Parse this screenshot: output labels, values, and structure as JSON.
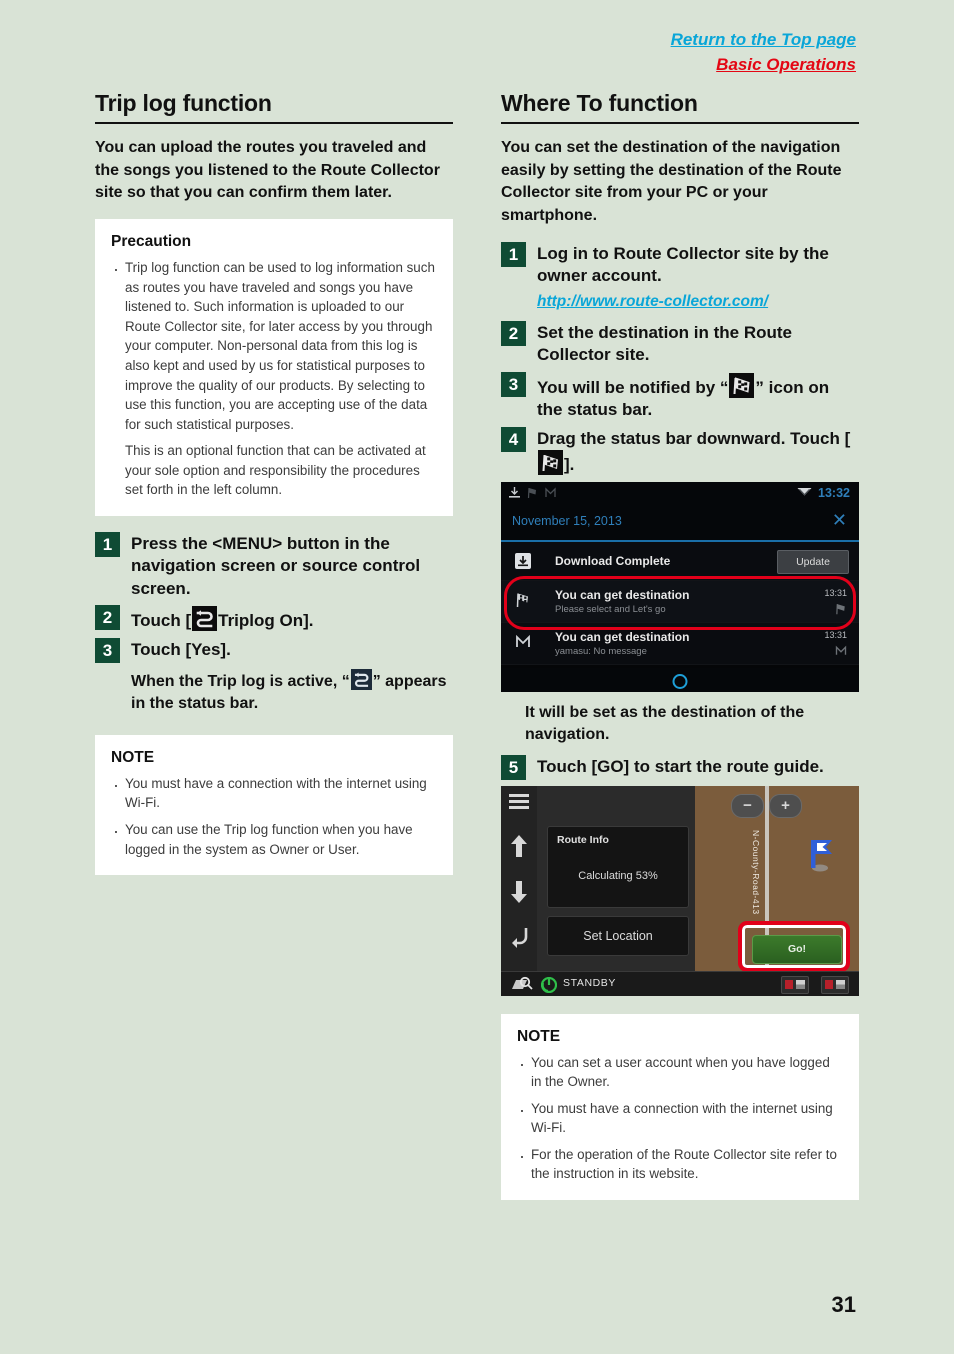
{
  "top_links": {
    "return_top": "Return to the Top page",
    "basic_operations": "Basic Operations"
  },
  "left_column": {
    "title": "Trip log function",
    "lede": "You can upload the routes you traveled and the songs you listened to the Route Collector site so that you can confirm them later.",
    "precaution": {
      "heading": "Precaution",
      "items": [
        "Trip log function can be used to log information such as routes you have traveled and songs you have listened to. Such information is uploaded to our Route Collector site, for later access by you through your computer. Non-personal data from this log is also kept and used by us for statistical purposes to improve the quality of our products. By selecting to use this function, you are accepting use of the data for such statistical purposes.",
        "This is an optional function that can be activated at your sole option and responsibility the procedures set forth in the left column."
      ]
    },
    "steps": [
      {
        "num": "1",
        "text": "Press the <MENU> button in the navigation screen or source control screen."
      },
      {
        "num": "2",
        "text_before": "Touch [",
        "icon": "triplog-icon",
        "text_after": "Triplog On]."
      },
      {
        "num": "3",
        "text": "Touch [Yes]."
      }
    ],
    "after_step": {
      "before": "When the Trip log is active, “",
      "icon": "triplog-icon",
      "after": "” appears in the status bar."
    },
    "note": {
      "heading": "NOTE",
      "items": [
        "You must have a connection with the internet using Wi-Fi.",
        "You can use the Trip log function when you have logged in the system as Owner or User."
      ]
    }
  },
  "right_column": {
    "title": "Where To function",
    "lede": "You can set the destination of the navigation easily by setting the destination of the Route Collector site from your PC or your smartphone.",
    "steps": [
      {
        "num": "1",
        "text": "Log in to Route Collector site by the owner account."
      },
      {
        "num": "2",
        "text": "Set the destination in the Route Collector site."
      },
      {
        "num": "3",
        "text_before": "You will be notified by “",
        "icon": "checkered-flag-icon",
        "text_after": "” icon on the status bar."
      },
      {
        "num": "4",
        "text_before": "Drag the status bar downward. Touch [",
        "icon": "checkered-flag-icon",
        "text_after": "]."
      },
      {
        "num": "5",
        "text": "Touch [GO] to start the route guide."
      }
    ],
    "url": "http://www.route-collector.com/",
    "after_notif_shot": "It will be set as the destination of the navigation.",
    "note": {
      "heading": "NOTE",
      "items": [
        "You can set a user account when you have logged in the Owner.",
        "You must have a connection with the internet using Wi-Fi.",
        "For the operation of the Route Collector site refer to the instruction in its website."
      ]
    }
  },
  "notification_shot": {
    "clock": "13:32",
    "date": "November 15, 2013",
    "close_glyph": "✕",
    "download_row": {
      "title": "Download Complete",
      "button": "Update"
    },
    "rows": [
      {
        "title": "You can get destination",
        "subtitle": "Please select and Let's go",
        "time": "13:31",
        "icon": "checkered-flag-icon",
        "highlighted": true
      },
      {
        "title": "You can get destination",
        "subtitle": "yamasu: No message",
        "time": "13:31",
        "icon": "mail-m-icon",
        "highlighted": false
      }
    ]
  },
  "map_shot": {
    "route_info_title": "Route Info",
    "calculating": "Calculating 53%",
    "set_location": "Set Location",
    "go_button": "Go!",
    "road_label": "N-County-Road-413",
    "zoom_out": "−",
    "zoom_in": "+",
    "status": "STANDBY"
  },
  "page_number": "31",
  "colors": {
    "page_background": "#d9e3d6",
    "step_number_background": "#0f4b34",
    "link_blue": "#0aa6d8",
    "link_red": "#e40613",
    "highlight_red": "#e2001a",
    "go_green": "#3c7a2b"
  }
}
